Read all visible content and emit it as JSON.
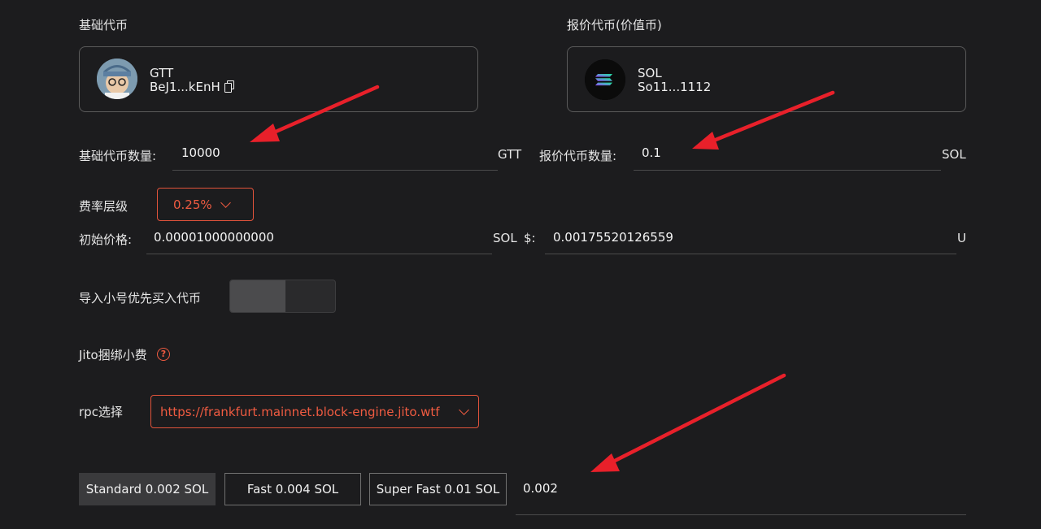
{
  "base_token": {
    "section_label": "基础代币",
    "symbol": "GTT",
    "address": "BeJ1...kEnH",
    "copy_icon": "copy-icon"
  },
  "quote_token": {
    "section_label": "报价代币(价值币)",
    "symbol": "SOL",
    "address": "So11...1112"
  },
  "base_amount": {
    "label": "基础代币数量:",
    "value": "10000",
    "unit": "GTT"
  },
  "quote_amount": {
    "label": "报价代币数量:",
    "value": "0.1",
    "unit": "SOL"
  },
  "fee_tier": {
    "label": "费率层级",
    "selected": "0.25%"
  },
  "initial_price": {
    "label": "初始价格:",
    "value": "0.00001000000000",
    "unit": "SOL",
    "usd_label": "$:",
    "usd_value": "0.00175520126559",
    "usd_unit": "U"
  },
  "import_sub": {
    "label": "导入小号优先买入代币",
    "enabled": false
  },
  "jito": {
    "label": "Jito捆绑小费",
    "help_icon": "question-icon"
  },
  "rpc": {
    "label": "rpc选择",
    "selected": "https://frankfurt.mainnet.block-engine.jito.wtf"
  },
  "tip_options": [
    {
      "label": "Standard 0.002 SOL",
      "active": true
    },
    {
      "label": "Fast 0.004 SOL",
      "active": false
    },
    {
      "label": "Super Fast 0.01 SOL",
      "active": false
    }
  ],
  "tip_value": "0.002",
  "colors": {
    "accent": "#ef5b41",
    "arrow": "#e8202a",
    "background": "#1c1c1e"
  }
}
